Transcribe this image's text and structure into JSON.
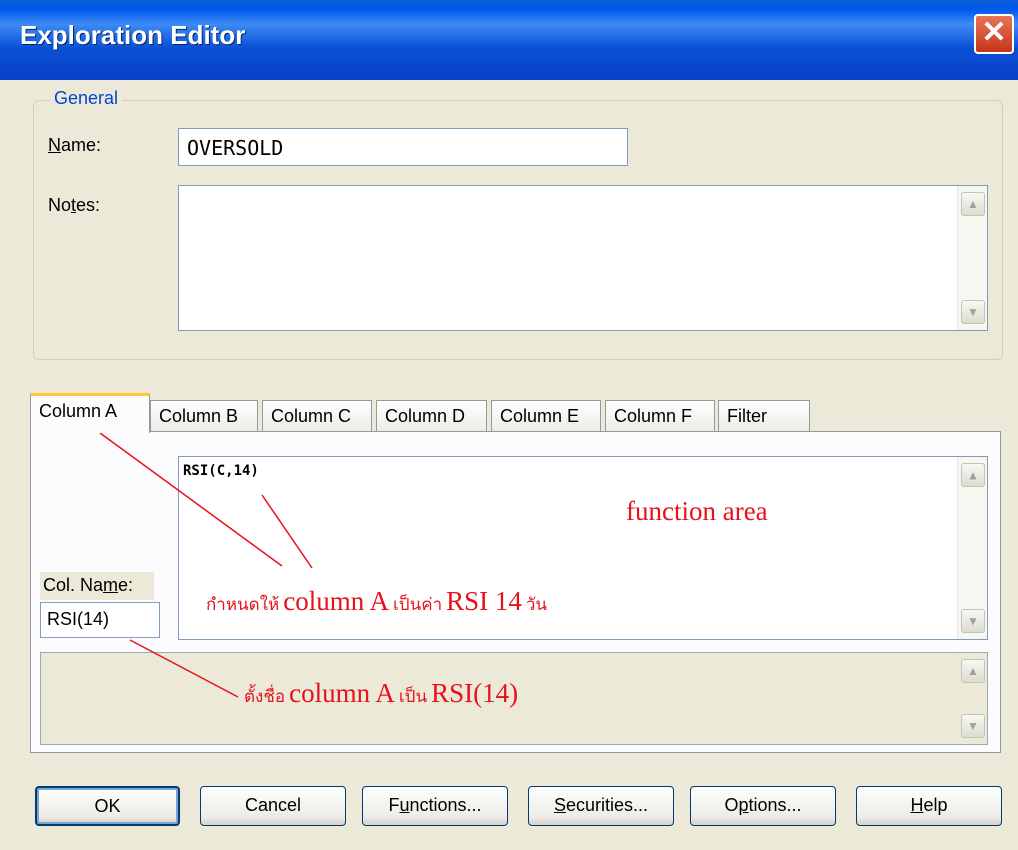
{
  "window": {
    "title": "Exploration Editor",
    "close_glyph": "✕"
  },
  "general": {
    "group_label": "General",
    "name_label_u": "N",
    "name_label_rest": "ame:",
    "name_value": "OVERSOLD",
    "notes_label_pre": "No",
    "notes_label_u": "t",
    "notes_label_post": "es:",
    "notes_value": ""
  },
  "tabs": [
    "Column A",
    "Column B",
    "Column C",
    "Column D",
    "Column E",
    "Column F",
    "Filter"
  ],
  "active_tab": "Column A",
  "column": {
    "formula": "RSI(C,14)",
    "col_name_label_pre": "Col. Na",
    "col_name_label_u": "m",
    "col_name_label_post": "e:",
    "col_name_value": "RSI(14)"
  },
  "annotations": {
    "function_area": "function area",
    "define_small": "กำหนดให้",
    "define_big1": "column A",
    "define_small2": "เป็นค่า",
    "define_big2": "RSI 14",
    "define_small3": "วัน",
    "name_small": "ตั้งชื่อ",
    "name_big": "column A",
    "name_small2": "เป็น",
    "name_big2": "RSI(14)"
  },
  "buttons": {
    "ok": "OK",
    "cancel": "Cancel",
    "functions_u": "u",
    "functions_pre": "F",
    "functions_post": "nctions...",
    "securities_u": "S",
    "securities_post": "ecurities...",
    "options_u": "p",
    "options_pre": "O",
    "options_post": "tions...",
    "help_u": "H",
    "help_post": "elp"
  },
  "colors": {
    "annotation": "#E8101A",
    "title_bar": "#0A4FD6",
    "group_label": "#0046D5"
  }
}
